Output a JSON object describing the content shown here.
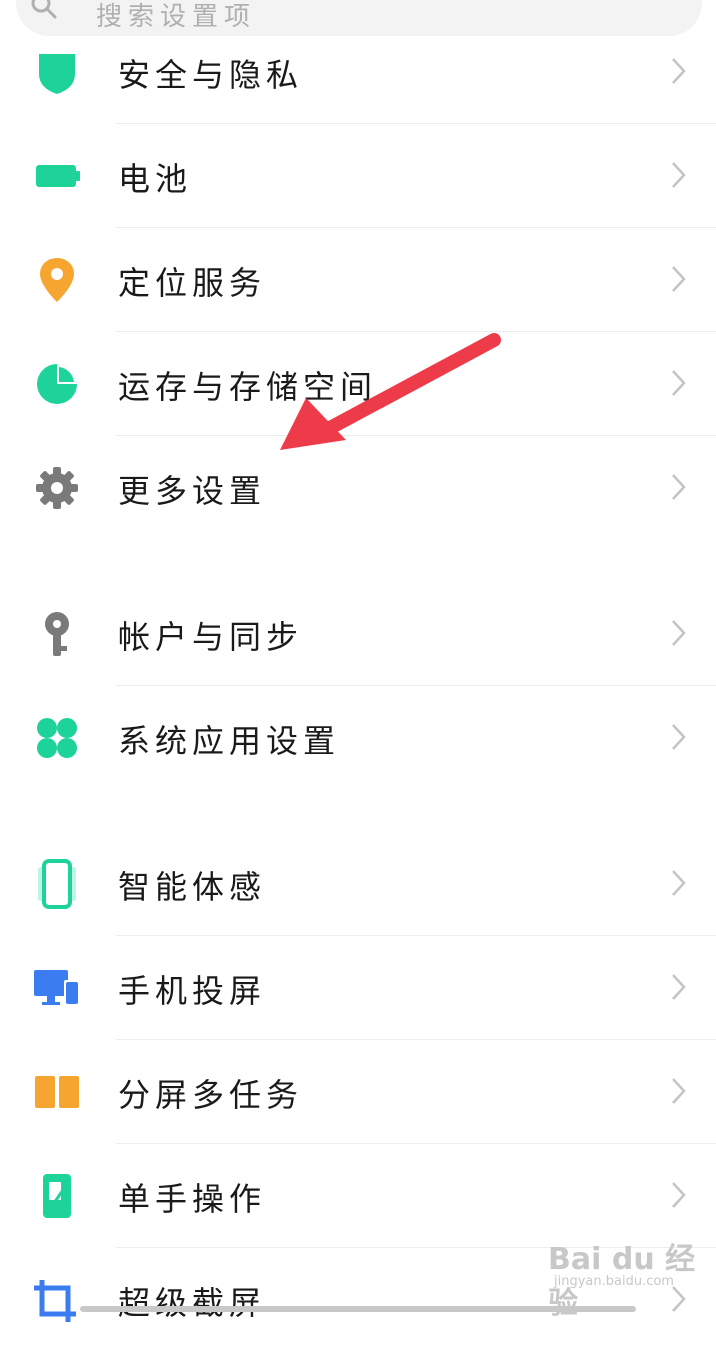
{
  "search": {
    "placeholder": "搜索设置项"
  },
  "groups": [
    [
      {
        "label": "安全与隐私",
        "icon": "shield-icon"
      },
      {
        "label": "电池",
        "icon": "battery-icon"
      },
      {
        "label": "定位服务",
        "icon": "location-pin-icon"
      },
      {
        "label": "运存与存储空间",
        "icon": "pie-chart-icon"
      },
      {
        "label": "更多设置",
        "icon": "gear-icon"
      }
    ],
    [
      {
        "label": "帐户与同步",
        "icon": "key-icon"
      },
      {
        "label": "系统应用设置",
        "icon": "four-petal-apps-icon"
      }
    ],
    [
      {
        "label": "智能体感",
        "icon": "phone-motion-icon"
      },
      {
        "label": "手机投屏",
        "icon": "screen-cast-icon"
      },
      {
        "label": "分屏多任务",
        "icon": "split-screen-icon"
      },
      {
        "label": "单手操作",
        "icon": "one-hand-icon"
      },
      {
        "label": "超级截屏",
        "icon": "crop-screenshot-icon"
      }
    ]
  ],
  "watermark": {
    "logo": "Bai du 经验",
    "url": "jingyan.baidu.com"
  },
  "colors": {
    "green": "#1ed39a",
    "orange": "#f7a531",
    "blue": "#3b7cf0",
    "gray": "#7a7a7a",
    "arrow": "#ee3b4a"
  }
}
